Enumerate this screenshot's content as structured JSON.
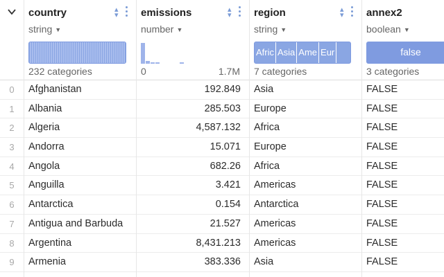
{
  "columns": [
    {
      "name": "country",
      "type": "string",
      "summary": "232 categories"
    },
    {
      "name": "emissions",
      "type": "number",
      "range_min": "0",
      "range_max": "1.7M",
      "histogram": [
        0.95,
        0.12,
        0.05,
        0.05,
        0.0,
        0.0,
        0.0,
        0.0,
        0.04,
        0.0,
        0.0,
        0.0,
        0.0,
        0.0,
        0.0,
        0.0,
        0.0,
        0.0,
        0.0,
        0.0
      ]
    },
    {
      "name": "region",
      "type": "string",
      "summary": "7 categories",
      "category_chips": [
        "Afric",
        "Asia",
        "Ame",
        "Eur"
      ]
    },
    {
      "name": "annex2",
      "type": "boolean",
      "summary": "3 categories",
      "bool_value": "false"
    }
  ],
  "index": [
    "0",
    "1",
    "2",
    "3",
    "4",
    "5",
    "6",
    "7",
    "8",
    "9"
  ],
  "rows": [
    [
      "Afghanistan",
      "192.849",
      "Asia",
      "FALSE"
    ],
    [
      "Albania",
      "285.503",
      "Europe",
      "FALSE"
    ],
    [
      "Algeria",
      "4,587.132",
      "Africa",
      "FALSE"
    ],
    [
      "Andorra",
      "15.071",
      "Europe",
      "FALSE"
    ],
    [
      "Angola",
      "682.26",
      "Africa",
      "FALSE"
    ],
    [
      "Anguilla",
      "3.421",
      "Americas",
      "FALSE"
    ],
    [
      "Antarctica",
      "0.154",
      "Antarctica",
      "FALSE"
    ],
    [
      "Antigua and Barbuda",
      "21.527",
      "Americas",
      "FALSE"
    ],
    [
      "Argentina",
      "8,431.213",
      "Americas",
      "FALSE"
    ],
    [
      "Armenia",
      "383.336",
      "Asia",
      "FALSE"
    ]
  ],
  "colors": {
    "accent": "#7f9be0",
    "accent_light": "#a9bdee"
  }
}
